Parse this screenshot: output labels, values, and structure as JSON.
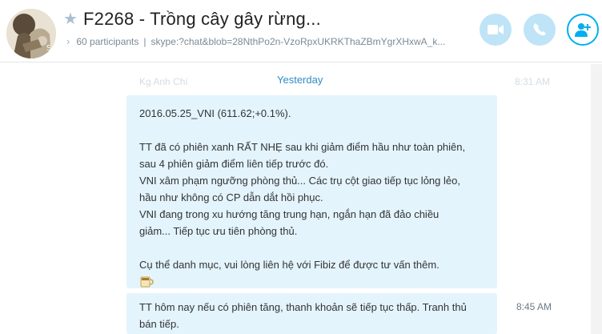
{
  "header": {
    "title": "F2268 - Trồng cây gây rừng...",
    "participants": "60 participants",
    "separator": "|",
    "link": "skype:?chat&blob=28NthPo2n-VzoRpxUKRKThaZBmYgrXHxwA_k...",
    "avatar_icon": "group-avatar-icon",
    "star_icon": "favorite-star-icon",
    "buttons": [
      "video-call-icon",
      "audio-call-icon",
      "add-participant-icon"
    ]
  },
  "chat": {
    "ghost_sender": "Kg Anh Chí",
    "ghost_time": "8:31 AM",
    "date_separator": "Yesterday",
    "messages": [
      {
        "lines": [
          "2016.05.25_VNI (611.62;+0.1%).",
          "",
          "TT đã có phiên xanh RẤT NHẸ sau khi giảm điểm hầu như toàn phiên,",
          "sau 4 phiên giảm điểm liên tiếp trước đó.",
          "VNI xâm phạm ngưỡng phòng thủ... Các trụ cột giao tiếp tục lỏng lẻo,",
          "hầu như không có CP dẫn dắt hồi phục.",
          "VNI đang trong xu hướng tăng trung hạn, ngắn hạn đã đảo chiều",
          "giảm... Tiếp tục ưu tiên phòng thủ.",
          "",
          "Cụ thể danh mục, vui lòng liên hệ với Fibiz để được tư vấn thêm."
        ],
        "emoticon": "coffee-cup-icon",
        "time": ""
      },
      {
        "lines": [
          "TT hôm nay nếu có phiên tăng, thanh khoản sẽ tiếp tục thấp. Tranh thủ",
          "bán tiếp."
        ],
        "time": "8:45 AM"
      }
    ]
  },
  "colors": {
    "accent": "#00aff0",
    "bubble": "#e3f4fd",
    "button_light": "#bfe3f7",
    "date_text": "#2f8cc9"
  }
}
